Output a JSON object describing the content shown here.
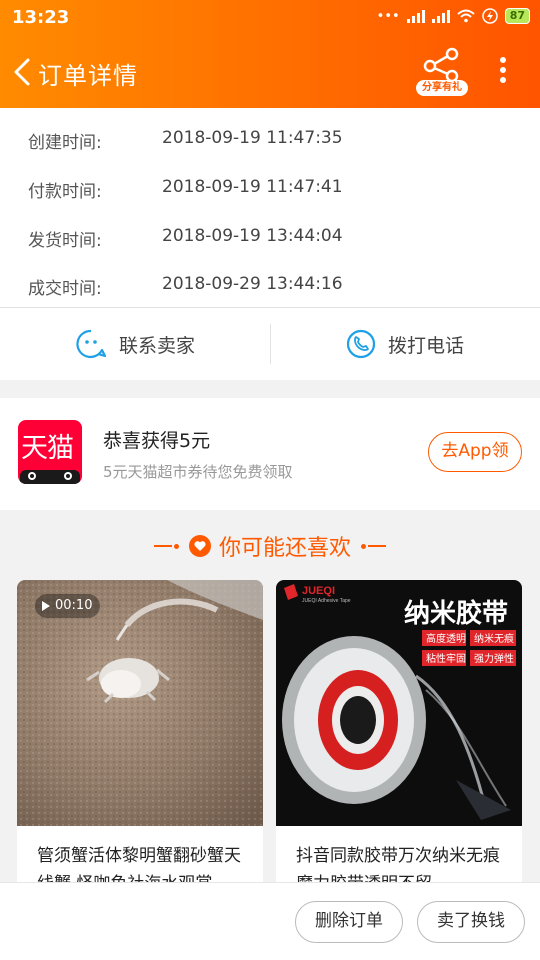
{
  "status_bar": {
    "time": "13:23",
    "battery": "87"
  },
  "nav": {
    "title": "订单详情",
    "share_label": "分享有礼"
  },
  "order_times": [
    {
      "label": "创建时间:",
      "value": "2018-09-19 11:47:35"
    },
    {
      "label": "付款时间:",
      "value": "2018-09-19 11:47:41"
    },
    {
      "label": "发货时间:",
      "value": "2018-09-19 13:44:04"
    },
    {
      "label": "成交时间:",
      "value": "2018-09-29 13:44:16"
    }
  ],
  "contact": {
    "seller_label": "联系卖家",
    "phone_label": "拨打电话"
  },
  "promo": {
    "logo_text": "天猫",
    "title": "恭喜获得5元",
    "subtitle": "5元天猫超市券待您免费领取",
    "button": "去App领"
  },
  "recommend": {
    "title": "你可能还喜欢",
    "items": [
      {
        "video_duration": "00:10",
        "title": "管须蟹活体黎明蟹翻砂蟹天线蟹 怪咖鱼社海水观赏"
      },
      {
        "brand": "JUEQI",
        "brand_sub": "JUEQI Adhesive Tape",
        "banner": "纳米胶带",
        "tags": [
          "高度透明",
          "纳米无痕",
          "粘性牢固",
          "强力弹性"
        ],
        "title": "抖音同款胶带万次纳米无痕魔力胶带透明不留"
      }
    ]
  },
  "bottom_bar": {
    "delete_label": "删除订单",
    "sell_label": "卖了换钱"
  },
  "colors": {
    "accent": "#ff5a00",
    "tmall": "#ff0036",
    "header_start": "#ff8b00",
    "header_end": "#ff5400"
  }
}
